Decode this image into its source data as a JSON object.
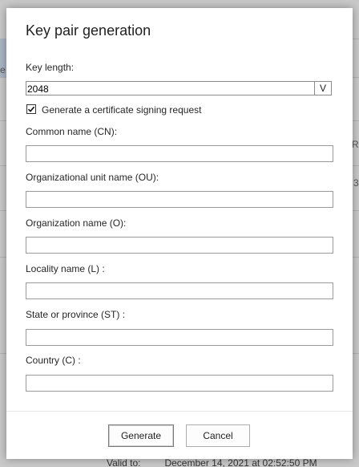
{
  "background": {
    "edge_texts": [
      "e",
      "Re",
      "3"
    ],
    "bottom_row": {
      "label": "Valid to:",
      "value": "December 14, 2021 at 02:52:50 PM"
    }
  },
  "dialog": {
    "title": "Key pair generation",
    "key_length": {
      "label": "Key length:",
      "selected": "2048",
      "arrow": "V"
    },
    "csr_checkbox": {
      "label": "Generate a certificate signing request",
      "checked": true
    },
    "fields": [
      {
        "label": "Common name (CN):",
        "value": ""
      },
      {
        "label": "Organizational unit name (OU):",
        "value": ""
      },
      {
        "label": "Organization name (O):",
        "value": ""
      },
      {
        "label": "Locality name (L) :",
        "value": ""
      },
      {
        "label": "State or province (ST) :",
        "value": ""
      },
      {
        "label": "Country (C) :",
        "value": ""
      }
    ],
    "buttons": {
      "generate": "Generate",
      "cancel": "Cancel"
    }
  },
  "icons": {
    "checkbox_mark": "checkmark-icon",
    "select_arrow": "chevron-down-icon"
  },
  "colors": {
    "dialog_bg": "#ffffff",
    "backdrop": "#c9c9c9",
    "border": "#9a9a9a"
  }
}
